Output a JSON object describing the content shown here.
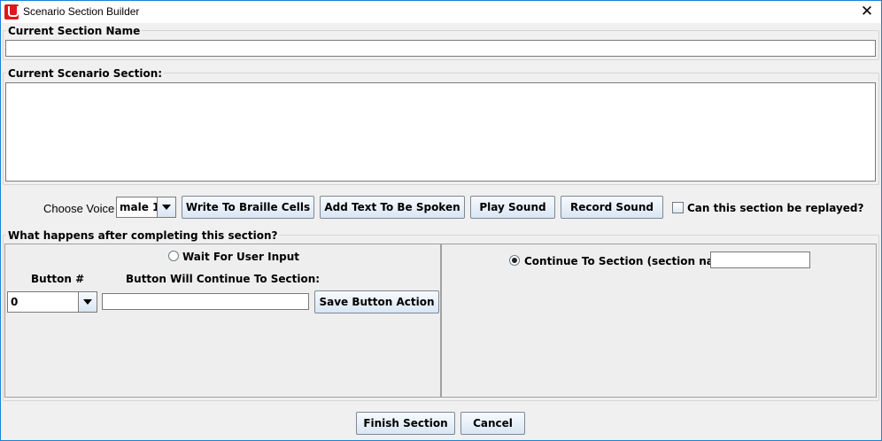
{
  "window": {
    "title": "Scenario Section Builder",
    "icon": "app-logo-icon",
    "close_icon": "close-icon"
  },
  "section_name": {
    "legend": "Current Section Name",
    "value": ""
  },
  "scenario_section": {
    "legend": "Current Scenario Section:",
    "value": ""
  },
  "toolbar": {
    "choose_voice_label": "Choose Voice",
    "voice_selected": "male 1",
    "write_braille_label": "Write To Braille Cells",
    "add_text_label": "Add Text To Be Spoken",
    "play_sound_label": "Play Sound",
    "record_sound_label": "Record Sound",
    "replay_checkbox_label": "Can this section be replayed?",
    "replay_checked": false
  },
  "after_section": {
    "legend": "What happens after completing this section?",
    "wait_radio_label": "Wait For User Input",
    "wait_selected": false,
    "button_num_label": "Button #",
    "button_continue_label": "Button Will Continue To Section:",
    "button_selected": "0",
    "button_continue_value": "",
    "save_button_label": "Save Button Action",
    "continue_radio_label": "Continue To Section (section name)",
    "continue_selected": true,
    "continue_value": ""
  },
  "footer": {
    "finish_label": "Finish Section",
    "cancel_label": "Cancel"
  }
}
